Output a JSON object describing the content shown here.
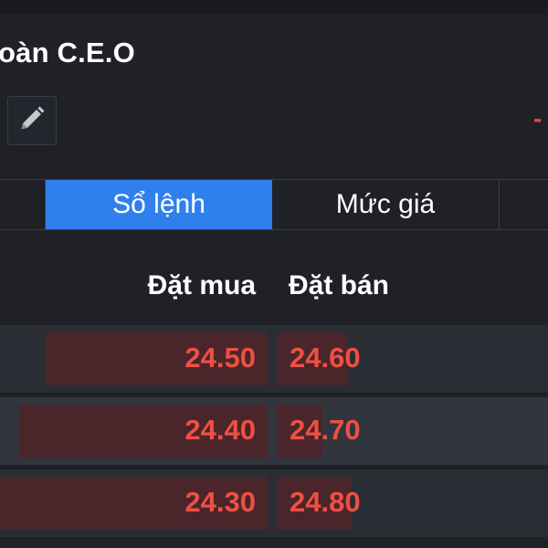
{
  "stock": {
    "title": "oàn C.E.O",
    "change_partial": "-"
  },
  "toolbar": {
    "edit_icon": "pencil-icon"
  },
  "tabs": [
    {
      "label": "Sổ lệnh",
      "active": true
    },
    {
      "label": "Mức giá",
      "active": false
    }
  ],
  "order_book": {
    "headers": {
      "bid": "Đặt mua",
      "ask": "Đặt bán"
    },
    "rows": [
      {
        "bid_price": "24.50",
        "ask_price": "24.60",
        "bid_volume_fraction": 0.83,
        "ask_volume_fraction": 0.48
      },
      {
        "bid_price": "24.40",
        "ask_price": "24.70",
        "bid_volume_fraction": 0.93,
        "ask_volume_fraction": 0.31
      },
      {
        "bid_price": "24.30",
        "ask_price": "24.80",
        "bid_volume_fraction": 1.0,
        "ask_volume_fraction": 0.51
      }
    ]
  },
  "colors": {
    "background": "#1f2127",
    "active_tab": "#2f80ed",
    "price_red": "#ef5043",
    "depth_bar": "#4a262b"
  }
}
